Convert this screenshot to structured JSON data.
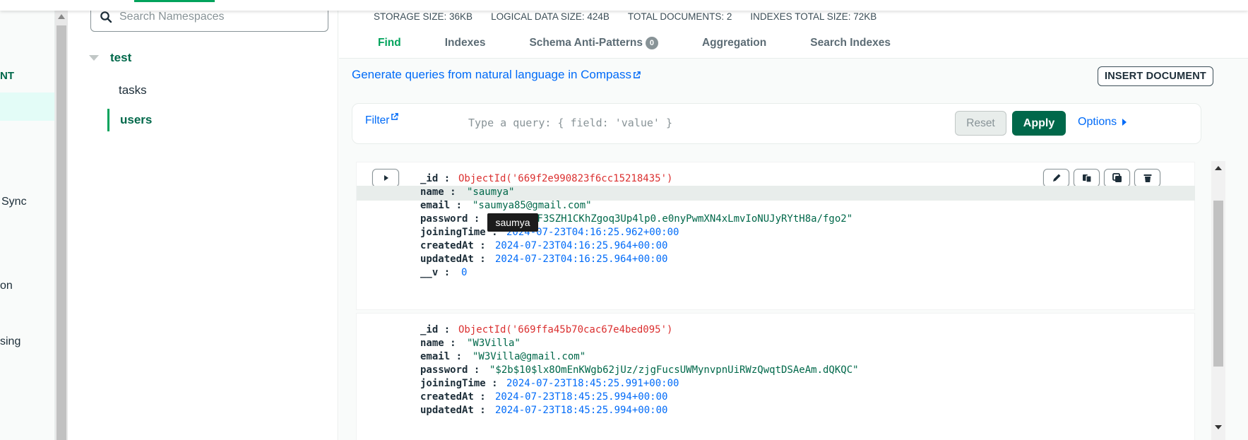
{
  "leftnav": {
    "items": [
      "NT",
      "Sync",
      "on",
      "sing"
    ]
  },
  "namespaces": {
    "search_placeholder": "Search Namespaces",
    "database": "test",
    "collections": [
      "tasks",
      "users"
    ]
  },
  "stats": {
    "storage": "STORAGE SIZE: 36KB",
    "logical": "LOGICAL DATA SIZE: 424B",
    "documents": "TOTAL DOCUMENTS: 2",
    "indexes": "INDEXES TOTAL SIZE: 72KB"
  },
  "tabs": {
    "find": "Find",
    "indexes": "Indexes",
    "schema": "Schema Anti-Patterns",
    "schema_badge": "0",
    "aggregation": "Aggregation",
    "search": "Search Indexes"
  },
  "toolbar": {
    "generate_link": "Generate queries from natural language in Compass",
    "insert_label": "INSERT DOCUMENT"
  },
  "filter": {
    "label": "Filter",
    "placeholder": "Type a query: { field: 'value' }",
    "reset": "Reset",
    "apply": "Apply",
    "options": "Options"
  },
  "documents": [
    {
      "fields": [
        {
          "key": "_id :",
          "value": "ObjectId('669f2e990823f6cc15218435')",
          "type": "oid"
        },
        {
          "key": "name :",
          "value": "\"saumya\"",
          "type": "str"
        },
        {
          "key": "email :",
          "value": "\"saumya85@gmail.com\"",
          "type": "str"
        },
        {
          "key": "password :",
          "value": "\"$2b$10$F3SZH1CKhZgoq3Up4lp0.e0nyPwmXN4xLmvIoNUJyRYtH8a/fgo2\"",
          "type": "str"
        },
        {
          "key": "joiningTime :",
          "value": "2024-07-23T04:16:25.962+00:00",
          "type": "date"
        },
        {
          "key": "createdAt :",
          "value": "2024-07-23T04:16:25.964+00:00",
          "type": "date"
        },
        {
          "key": "updatedAt :",
          "value": "2024-07-23T04:16:25.964+00:00",
          "type": "date"
        },
        {
          "key": "__v :",
          "value": "0",
          "type": "num"
        }
      ]
    },
    {
      "fields": [
        {
          "key": "_id :",
          "value": "ObjectId('669ffa45b70cac67e4bed095')",
          "type": "oid"
        },
        {
          "key": "name :",
          "value": "\"W3Villa\"",
          "type": "str"
        },
        {
          "key": "email :",
          "value": "\"W3Villa@gmail.com\"",
          "type": "str"
        },
        {
          "key": "password :",
          "value": "\"$2b$10$lx8OmEnKWgb62jUz/zjgFucsUWMynvpnUiRWzQwqtDSAeAm.dQKQC\"",
          "type": "str"
        },
        {
          "key": "joiningTime :",
          "value": "2024-07-23T18:45:25.991+00:00",
          "type": "date"
        },
        {
          "key": "createdAt :",
          "value": "2024-07-23T18:45:25.994+00:00",
          "type": "date"
        },
        {
          "key": "updatedAt :",
          "value": "2024-07-23T18:45:25.994+00:00",
          "type": "date"
        }
      ]
    }
  ],
  "tooltip": "saumya",
  "colors": {
    "brand_green": "#00684a",
    "accent_green": "#00a35c",
    "link_blue": "#016bf8",
    "oid_red": "#db3030"
  }
}
